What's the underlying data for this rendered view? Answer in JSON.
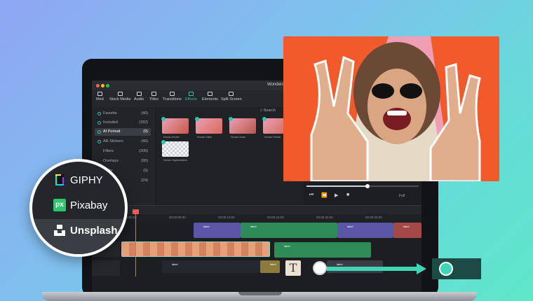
{
  "app": {
    "title": "Wondersh"
  },
  "toolbar": {
    "items": [
      {
        "label": "Med",
        "active": false
      },
      {
        "label": "Stock Media",
        "active": false
      },
      {
        "label": "Audio",
        "active": false
      },
      {
        "label": "Titles",
        "active": false
      },
      {
        "label": "Transitions",
        "active": false
      },
      {
        "label": "Effects",
        "active": true
      },
      {
        "label": "Elements",
        "active": false
      },
      {
        "label": "Split Screen",
        "active": false
      }
    ]
  },
  "sidebar": {
    "items": [
      {
        "label": "Favorite",
        "count": "(40)"
      },
      {
        "label": "Included",
        "count": "(332)"
      },
      {
        "label": "AI Portrait",
        "count": "(9)",
        "selected": true
      },
      {
        "label": "AR Stickers",
        "count": "(40)"
      },
      {
        "label": "Filters",
        "count": "(205)"
      },
      {
        "label": "Overlays",
        "count": "(95)"
      },
      {
        "label": "Utility",
        "count": "(9)"
      },
      {
        "label": "",
        "count": "(24)"
      }
    ]
  },
  "search": {
    "label": "Search"
  },
  "effects": [
    {
      "label": "Human Border"
    },
    {
      "label": "Human Glitch"
    },
    {
      "label": "Human Noise"
    },
    {
      "label": "Human Pixelat"
    },
    {
      "label": "Human Segmentation"
    }
  ],
  "playback": {
    "quality": "Full"
  },
  "timeline": {
    "ruler": [
      "00:00:00:00",
      "00:00:05:00",
      "00:00:10:00",
      "00:00:15:00",
      "00:00:20:00",
      "00:00:25:00",
      "00:00:30:00"
    ],
    "clips": {
      "label": "label"
    }
  },
  "stock": {
    "items": [
      {
        "label": "GIPHY",
        "icon": "giphy-icon"
      },
      {
        "label": "Pixabay",
        "icon": "pixabay-icon"
      },
      {
        "label": "Unsplash",
        "icon": "unsplash-icon"
      }
    ]
  },
  "text_tile": {
    "glyph": "T"
  },
  "colors": {
    "accent": "#27c7b0",
    "playhead": "#ff5c5c"
  }
}
